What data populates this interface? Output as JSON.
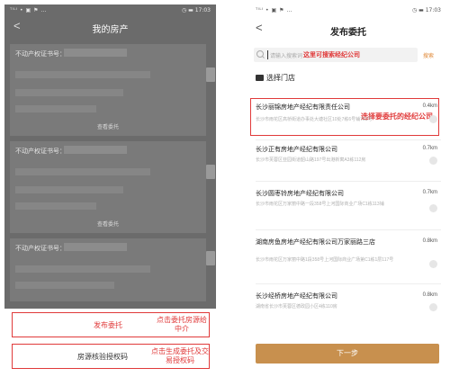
{
  "left": {
    "status_left": "ᵀᴵᴸᴵ • ▣ ⚑ …",
    "status_right": "◷ ▬ 17:03",
    "header": {
      "back": "<",
      "title": "我的房产"
    },
    "cards": [
      {
        "label": "不动产权证书号：",
        "link": "查看委托"
      },
      {
        "label": "不动产权证书号：",
        "link": "查看委托"
      },
      {
        "label": "不动产权证书号：",
        "link": ""
      }
    ],
    "buttons": {
      "entrust_label": "发布委托",
      "entrust_note": "点击委托房源给中介",
      "verify_label": "房源核验授权码",
      "verify_note": "点击生成委托及交易授权码"
    }
  },
  "right": {
    "status_left": "ᵀᴵᴸᴵ • ▣ ⚑ …",
    "status_right": "◷ ▬ 17:03",
    "header": {
      "back": "<",
      "title": "发布委托"
    },
    "search": {
      "placeholder": "请输入搜索词",
      "annotation": "这里可搜索经纪公司",
      "button": "搜索"
    },
    "section_title": "选择门店",
    "selected_annotation": "选择要委托的经纪公司",
    "stores": [
      {
        "name": "长沙丽锦房地产经纪有限责任公司",
        "distance": "0.4km",
        "address": "长沙市雨花区高桥街道办事处大塘社区10处7栋6号铺701号"
      },
      {
        "name": "长沙正有房地产经纪有限公司",
        "distance": "0.7km",
        "address": "长沙市芙蓉区韭园街道韶山路197号出港新寓A3栋112房"
      },
      {
        "name": "长沙圆枣铃房地产经纪有限公司",
        "distance": "0.7km",
        "address": "长沙市雨花区万家丽中路一段358号上河国际商业广场C1栋113铺"
      },
      {
        "name": "湖南房鱼房地产经纪有限公司万家丽路三店",
        "distance": "0.8km",
        "address": "长沙市雨花区万家丽中路1段358号上河国际商业广场第C1栋1层117号"
      },
      {
        "name": "长沙经桥房地产经纪有限公司",
        "distance": "0.8km",
        "address": "湖南省长沙市芙蓉区德政园小区4栋110房"
      }
    ],
    "next_button": "下一步"
  }
}
